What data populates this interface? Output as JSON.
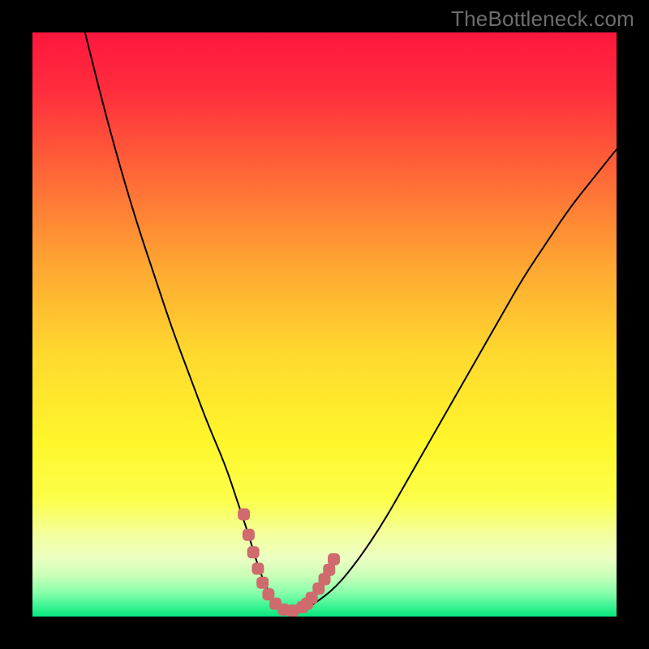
{
  "watermark": "TheBottleneck.com",
  "colors": {
    "frame": "#000000",
    "curve": "#000000",
    "marker_fill": "#cf6a6d",
    "marker_stroke": "#cf6a6d",
    "gradient_stops": [
      {
        "offset": 0.0,
        "color": "#ff173e"
      },
      {
        "offset": 0.1,
        "color": "#ff2d3d"
      },
      {
        "offset": 0.25,
        "color": "#ff6a37"
      },
      {
        "offset": 0.4,
        "color": "#ffa732"
      },
      {
        "offset": 0.55,
        "color": "#ffd92e"
      },
      {
        "offset": 0.7,
        "color": "#fff62b"
      },
      {
        "offset": 0.8,
        "color": "#fcff4a"
      },
      {
        "offset": 0.86,
        "color": "#f3ff9e"
      },
      {
        "offset": 0.9,
        "color": "#ecffc2"
      },
      {
        "offset": 0.93,
        "color": "#c9ffb8"
      },
      {
        "offset": 0.96,
        "color": "#86ffab"
      },
      {
        "offset": 0.985,
        "color": "#33f290"
      },
      {
        "offset": 1.0,
        "color": "#08e87f"
      }
    ]
  },
  "chart_data": {
    "type": "line",
    "title": "",
    "xlabel": "",
    "ylabel": "",
    "xlim": [
      0,
      100
    ],
    "ylim": [
      0,
      100
    ],
    "series": [
      {
        "name": "bottleneck-curve",
        "x": [
          9,
          12,
          15,
          18,
          21,
          24,
          27,
          30,
          33,
          35,
          37,
          38.5,
          40,
          42,
          44,
          46,
          48,
          52,
          56,
          60,
          64,
          68,
          72,
          76,
          80,
          84,
          88,
          92,
          96,
          100
        ],
        "y": [
          100,
          88,
          77,
          67,
          58,
          49,
          41,
          33,
          26,
          20,
          14,
          9,
          5,
          2,
          1,
          1,
          2,
          5,
          10,
          16,
          23,
          30,
          37,
          44,
          51,
          58,
          64,
          70,
          75,
          80
        ]
      }
    ],
    "markers": {
      "name": "highlight-points",
      "x": [
        36.2,
        37.0,
        37.8,
        38.6,
        39.4,
        40.4,
        41.6,
        43.0,
        44.6,
        46.2,
        47.0,
        47.8,
        49.0,
        50.0,
        50.8,
        51.6
      ],
      "y": [
        17.5,
        14.0,
        11.0,
        8.2,
        5.8,
        3.8,
        2.2,
        1.2,
        1.0,
        1.6,
        2.2,
        3.2,
        4.8,
        6.4,
        8.0,
        9.8
      ]
    }
  }
}
